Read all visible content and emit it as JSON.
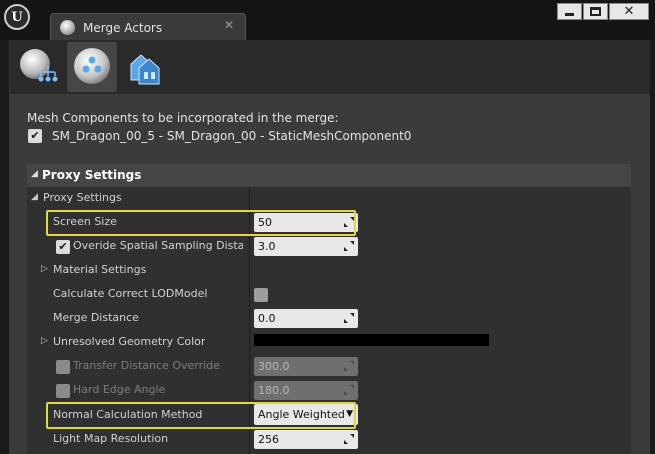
{
  "window": {
    "title": "Merge Actors",
    "close_tab_glyph": "✕",
    "app_logo": "U",
    "controls": {
      "minimize_icon": "minimize-icon",
      "maximize_icon": "maximize-icon",
      "close_glyph": "✕"
    }
  },
  "modes": [
    {
      "icon": "mesh-merge-icon",
      "active": false
    },
    {
      "icon": "proxy-mesh-icon",
      "active": true
    },
    {
      "icon": "mesh-instancing-icon",
      "active": false
    }
  ],
  "merge": {
    "components_label": "Mesh Components to be incorporated in the merge:",
    "component": {
      "label": "SM_Dragon_00_5 - SM_Dragon_00 - StaticMeshComponent0",
      "checked": true
    }
  },
  "category": {
    "title": "Proxy Settings",
    "expanded": true
  },
  "proxy_settings": {
    "label": "Proxy Settings",
    "rows": {
      "screen_size": {
        "label": "Screen Size",
        "value": "50"
      },
      "override_spatial": {
        "label": "Overide Spatial Sampling Distance",
        "value": "3.0",
        "checked": true
      },
      "material_settings": {
        "label": "Material Settings"
      },
      "calculate_correct_lod": {
        "label": "Calculate Correct LODModel",
        "checked": false
      },
      "merge_distance": {
        "label": "Merge Distance",
        "value": "0.0"
      },
      "unresolved_geometry_color": {
        "label": "Unresolved Geometry Color",
        "color": "#000000"
      },
      "transfer_distance_override": {
        "label": "Transfer Distance Override",
        "value": "300.0",
        "enabled": false
      },
      "hard_edge_angle": {
        "label": "Hard Edge Angle",
        "value": "180.0",
        "enabled": false
      },
      "normal_calculation_method": {
        "label": "Normal Calculation Method",
        "value": "Angle Weighted"
      },
      "light_map_resolution": {
        "label": "Light Map Resolution",
        "value": "256"
      }
    }
  },
  "colors": {
    "highlight": "#e5d73a",
    "panel": "#3b3b3b",
    "field": "#e8e8e8"
  }
}
